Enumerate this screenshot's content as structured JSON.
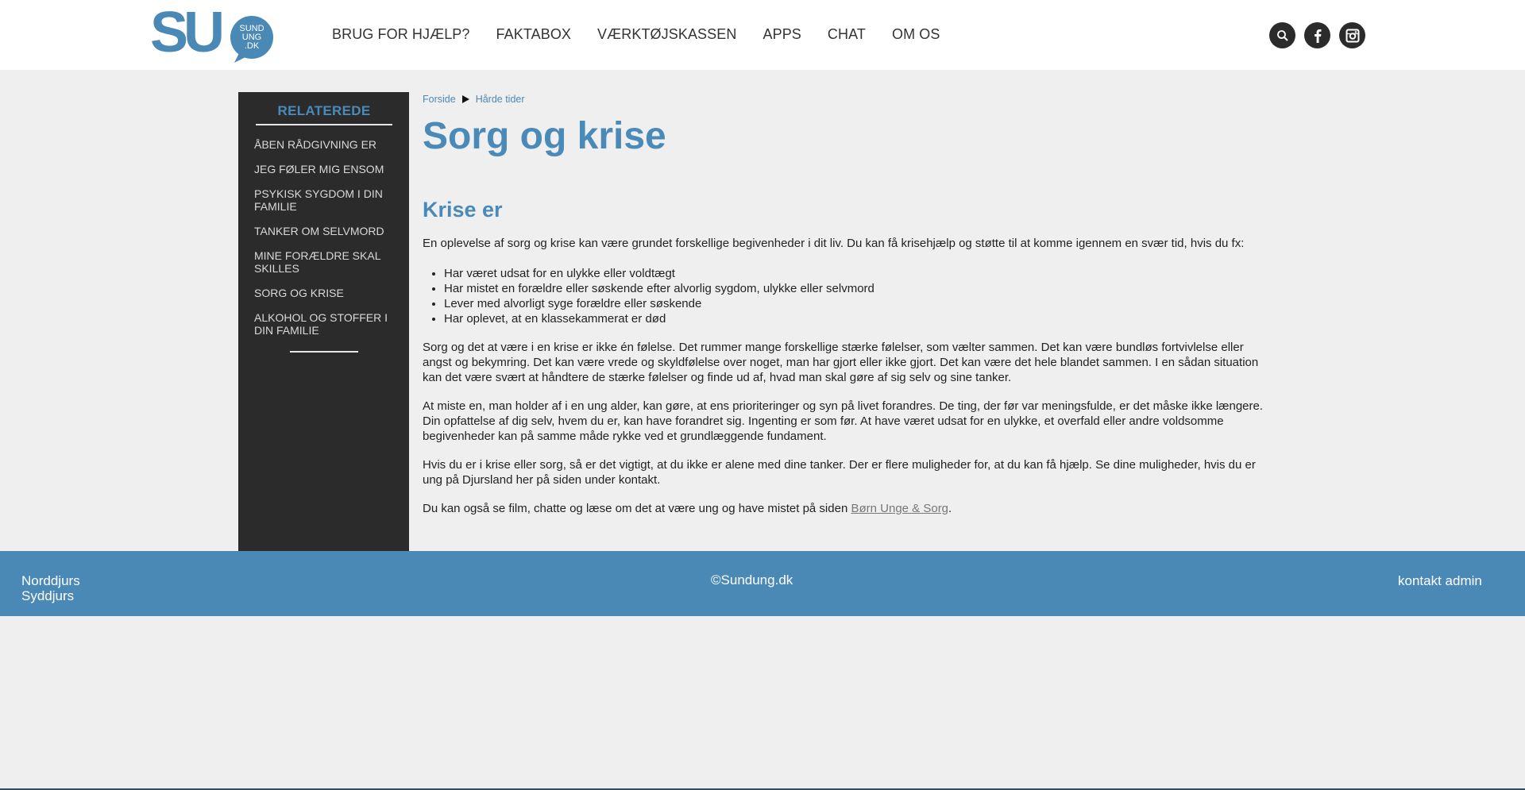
{
  "logo": {
    "big": "SU",
    "small1": "SUND",
    "small2": "UNG",
    "small3": ".DK"
  },
  "nav": [
    "BRUG FOR HJÆLP?",
    "FAKTABOX",
    "VÆRKTØJSKASSEN",
    "APPS",
    "CHAT",
    "OM OS"
  ],
  "social": {
    "icons": [
      "search-icon",
      "facebook-icon",
      "instagram-icon"
    ]
  },
  "sidebar": {
    "title": "RELATEREDE",
    "items": [
      "ÅBEN RÅDGIVNING ER",
      "JEG FØLER MIG ENSOM",
      "PSYKISK SYGDOM I DIN FAMILIE",
      "TANKER OM SELVMORD",
      "MINE FORÆLDRE SKAL SKILLES",
      "SORG OG KRISE",
      "ALKOHOL OG STOFFER I DIN FAMILIE"
    ]
  },
  "breadcrumb": {
    "home": "Forside",
    "current": "Hårde tider"
  },
  "article": {
    "title": "Sorg og krise",
    "subtitle": "Krise er",
    "intro": "En oplevelse af sorg og krise kan være grundet forskellige begivenheder i dit liv. Du kan få krisehjælp og støtte til at komme igennem en svær tid, hvis du fx:",
    "bullets": [
      "Har været udsat for en ulykke eller voldtægt",
      "Har mistet en forældre eller søskende efter alvorlig sygdom, ulykke eller selvmord",
      "Lever med alvorligt syge forældre eller søskende",
      "Har oplevet, at en klassekammerat er død"
    ],
    "p1": "Sorg og det at være i en krise er ikke én følelse. Det rummer mange forskellige stærke følelser, som vælter sammen. Det kan være bundløs fortvivlelse eller angst og bekymring. Det kan være vrede og skyldfølelse over noget, man har gjort eller ikke gjort. Det kan være det hele blandet sammen. I en sådan situation kan det være svært at håndtere de stærke følelser og finde ud af, hvad man skal gøre af sig selv og sine tanker.",
    "p2": "At miste en, man holder af i en ung alder, kan gøre, at ens prioriteringer og syn på livet forandres. De ting, der før var meningsfulde, er det måske ikke længere. Din opfattelse af dig selv, hvem du er, kan have forandret sig. Ingenting er som før. At have været udsat for en ulykke, et overfald eller andre voldsomme begivenheder kan på samme måde rykke ved et grundlæggende fundament.",
    "p3": "Hvis du er i krise eller sorg, så er det vigtigt, at du ikke er alene med dine tanker. Der er flere muligheder for, at du kan få hjælp. Se dine muligheder, hvis du er ung på Djursland her på siden under kontakt.",
    "p4_prefix": "Du kan også se film, chatte og læse om det at være ung og have mistet på siden ",
    "p4_link": "Børn Unge & Sorg",
    "p4_suffix": "."
  },
  "footer": {
    "left1": "Norddjurs",
    "left2": "Syddjurs",
    "center": "©Sundung.dk",
    "right": "kontakt admin"
  },
  "colors": {
    "accent": "#4a8ab8",
    "sidebar_bg": "#2b2b2b",
    "footer_bg": "#4a89b6",
    "page_bg": "#efefef"
  }
}
